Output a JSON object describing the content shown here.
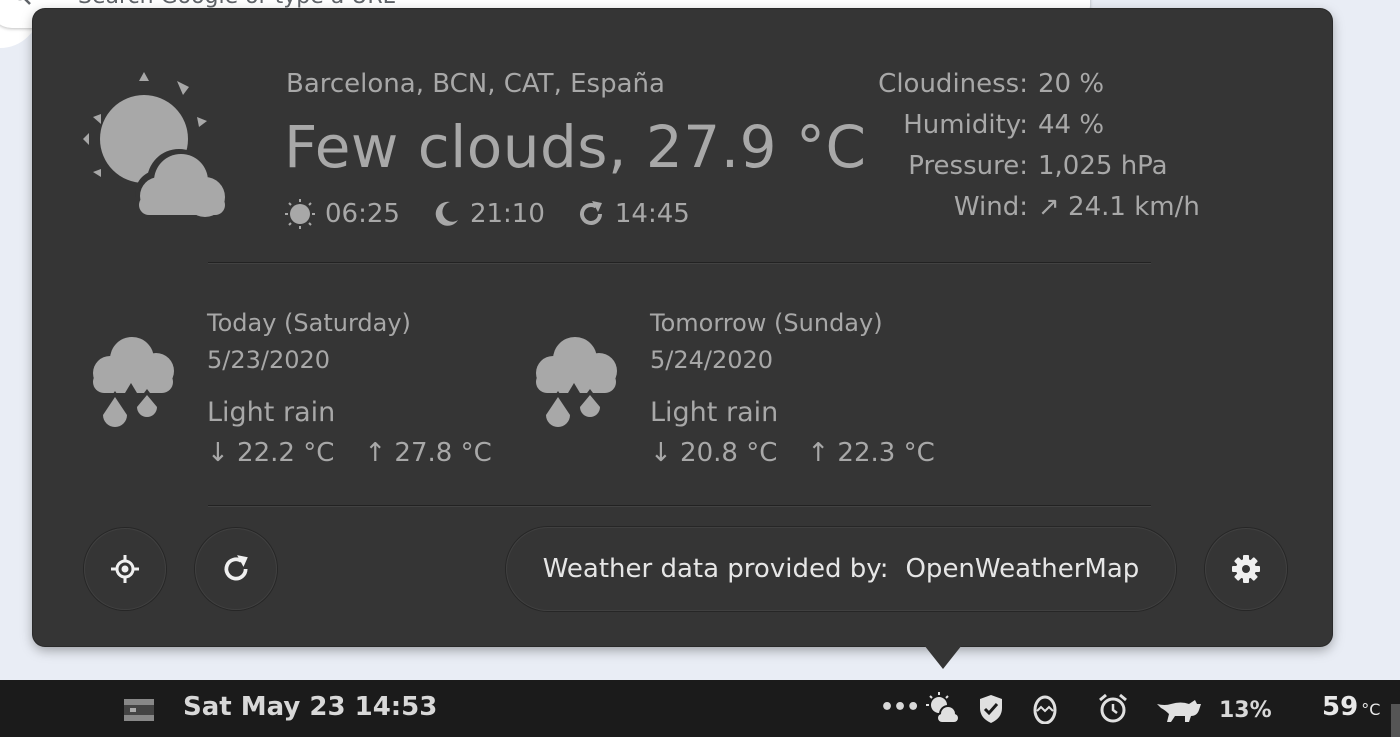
{
  "browser": {
    "search_placeholder": "Search Google or type a URL"
  },
  "weather": {
    "location": "Barcelona, BCN, CAT, España",
    "summary": "Few clouds, 27.9 °C",
    "sunrise": "06:25",
    "sunset": "21:10",
    "last_update": "14:45",
    "details": [
      {
        "label": "Cloudiness:",
        "value": "20 %"
      },
      {
        "label": "Humidity:",
        "value": "44 %"
      },
      {
        "label": "Pressure:",
        "value": "1,025 hPa"
      },
      {
        "label": "Wind:",
        "value": "↗ 24.1 km/h"
      }
    ],
    "forecast": [
      {
        "day": "Today (Saturday)",
        "date": "5/23/2020",
        "condition": "Light rain",
        "low": "↓ 22.2 °C",
        "high": "↑ 27.8 °C",
        "icon": "rain-cloud-icon"
      },
      {
        "day": "Tomorrow (Sunday)",
        "date": "5/24/2020",
        "condition": "Light rain",
        "low": "↓ 20.8 °C",
        "high": "↑ 22.3 °C",
        "icon": "rain-cloud-icon"
      }
    ],
    "provider_label": "Weather data provided by:",
    "provider_name": "OpenWeatherMap"
  },
  "taskbar": {
    "clock": "Sat May 23  14:53",
    "overflow": "•••",
    "battery": "13%",
    "temperature": "59",
    "temperature_unit": "°C"
  },
  "colors": {
    "popup_bg": "#353535",
    "text": "#a8a8a8",
    "taskbar_bg": "#1b1b1b"
  }
}
